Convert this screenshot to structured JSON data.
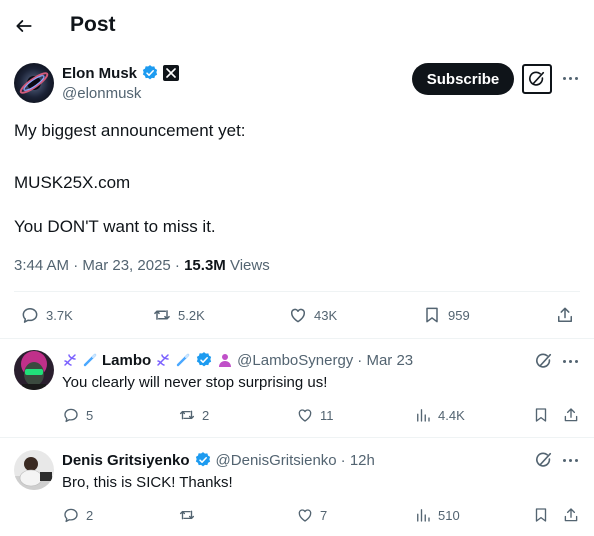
{
  "header": {
    "title": "Post"
  },
  "post": {
    "author_name": "Elon Musk",
    "handle": "@elonmusk",
    "subscribe_label": "Subscribe",
    "text_line1": "My biggest announcement yet:",
    "text_line2": "MUSK25X.com",
    "text_line3": "You DON'T want to miss it.",
    "timestamp": "3:44 AM · Mar 23, 2025 · ",
    "views_count": "15.3M",
    "views_label": " Views",
    "replies": "3.7K",
    "reposts": "5.2K",
    "likes": "43K",
    "bookmarks": "959"
  },
  "replies": [
    {
      "name": "Lambo",
      "handle": "@LamboSynergy",
      "date": "· Mar 23",
      "text": "You clearly will never stop surprising us!",
      "replies": "5",
      "reposts": "2",
      "likes": "11",
      "views": "4.4K"
    },
    {
      "name": "Denis Gritsiyenko",
      "handle": "@DenisGritsienko",
      "date": "· 12h",
      "text": "Bro, this is SICK! Thanks!",
      "replies": "2",
      "reposts": "",
      "likes": "7",
      "views": "510"
    }
  ],
  "icons": {
    "back": "arrow-left-icon",
    "verified": "verified-badge-icon",
    "x_logo": "x-logo-icon",
    "grok": "grok-icon",
    "more": "more-icon",
    "reply": "reply-icon",
    "repost": "repost-icon",
    "like": "like-icon",
    "bookmark": "bookmark-icon",
    "share": "share-icon",
    "views": "views-icon"
  },
  "colors": {
    "text": "#0f1419",
    "muted": "#536471",
    "verified": "#1d9bf0",
    "button": "#0f1419",
    "divider": "#eff3f4"
  }
}
